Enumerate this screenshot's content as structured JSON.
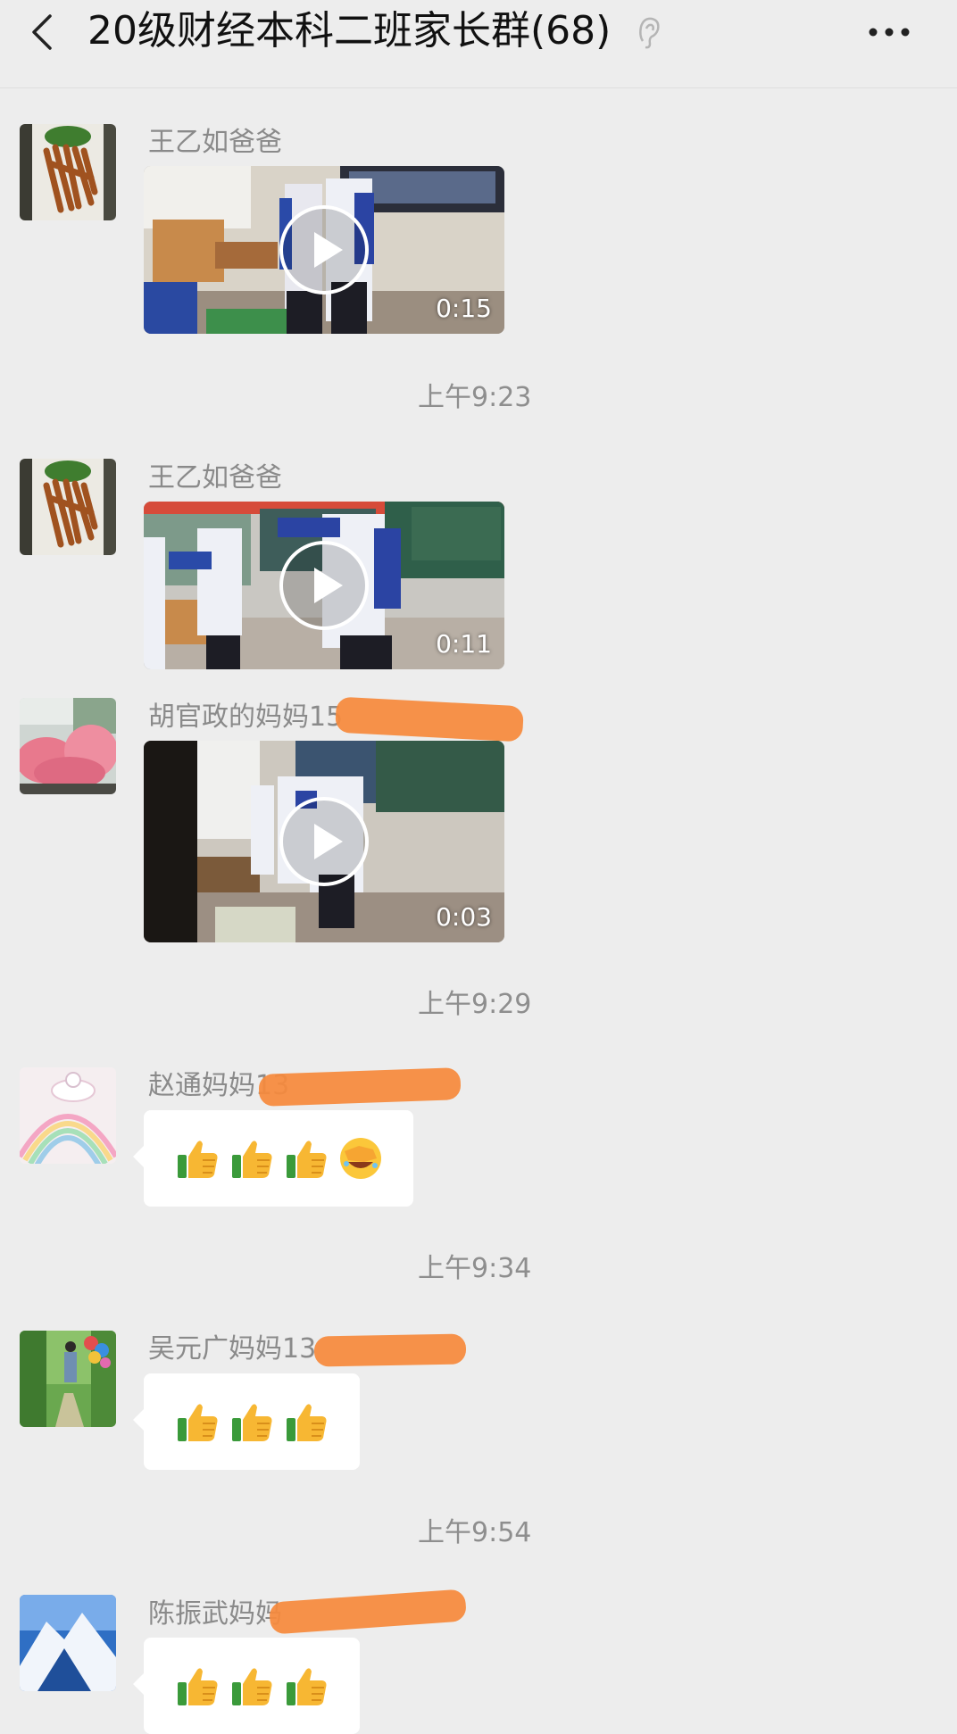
{
  "header": {
    "title": "20级财经本科二班家长群(68)",
    "back_icon": "chevron-left-icon",
    "ear_icon": "ear-icon",
    "more_icon": "more-dots-icon"
  },
  "messages": [
    {
      "sender": "王乙如爸爸",
      "type": "video",
      "duration": "0:15"
    },
    {
      "sender": "王乙如爸爸",
      "type": "video",
      "duration": "0:11"
    },
    {
      "sender": "胡官政的妈妈15",
      "type": "video",
      "duration": "0:03"
    },
    {
      "sender": "赵通妈妈13",
      "type": "emoji",
      "emojis": [
        "thumbs-up",
        "thumbs-up",
        "thumbs-up",
        "facepalm-laugh"
      ]
    },
    {
      "sender": "吴元广妈妈13",
      "type": "emoji",
      "emojis": [
        "thumbs-up",
        "thumbs-up",
        "thumbs-up"
      ]
    },
    {
      "sender": "陈振武妈妈",
      "type": "emoji",
      "emojis": [
        "thumbs-up",
        "thumbs-up",
        "thumbs-up"
      ]
    }
  ],
  "timestamps": [
    "上午9:23",
    "上午9:29",
    "上午9:34",
    "上午9:54"
  ],
  "colors": {
    "background": "#ededed",
    "bubble": "#ffffff",
    "redaction": "#f68a3c",
    "sender_text": "#8a8a8a"
  }
}
